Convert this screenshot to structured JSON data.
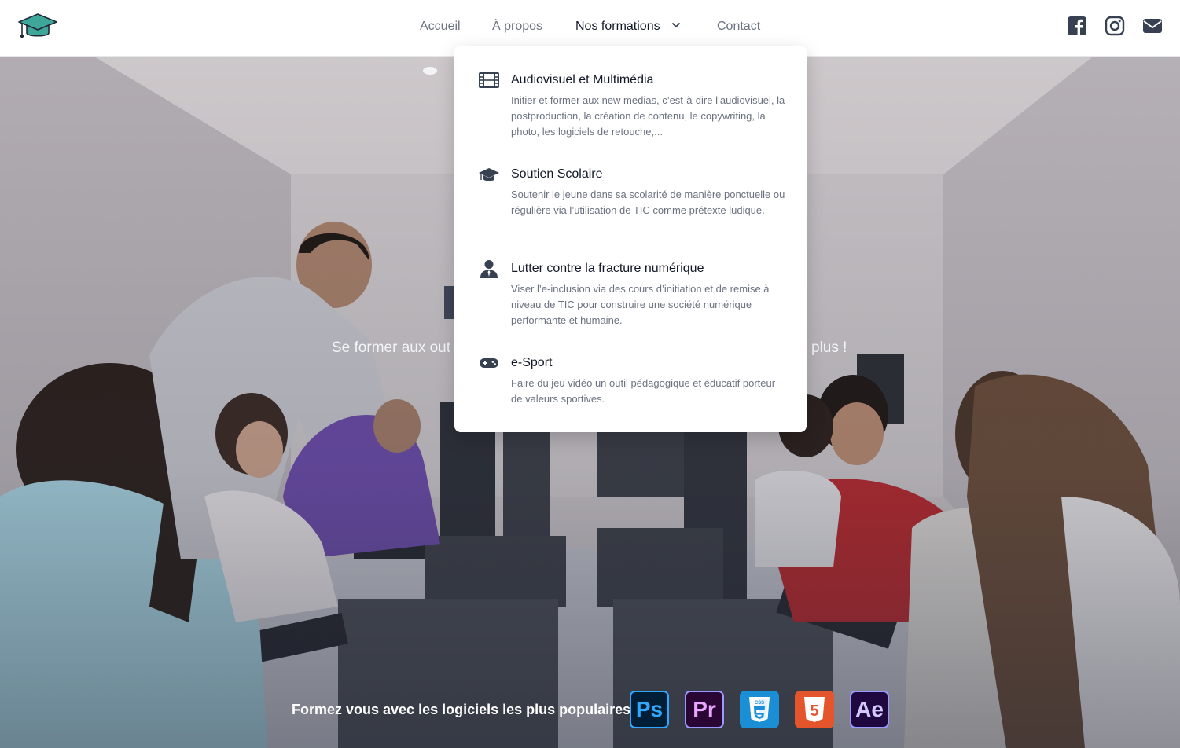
{
  "nav": {
    "items": [
      {
        "label": "Accueil"
      },
      {
        "label": "À propos"
      },
      {
        "label": "Nos formations"
      },
      {
        "label": "Contact"
      }
    ],
    "social": [
      "facebook-icon",
      "instagram-icon",
      "envelope-icon"
    ]
  },
  "dropdown": {
    "items": [
      {
        "icon": "film-icon",
        "title": "Audiovisuel et Multimédia",
        "description": "Initier et former aux new medias, c’est-à-dire l’audiovisuel, la postproduction, la création de contenu, le copywriting, la photo, les logiciels de retouche,..."
      },
      {
        "icon": "graduation-cap-icon",
        "title": "Soutien Scolaire",
        "description": "Soutenir le jeune dans sa scolarité de manière ponctuelle ou régulière via l’utilisation de TIC comme prétexte ludique."
      },
      {
        "icon": "user-tie-icon",
        "title": "Lutter contre la fracture numérique",
        "description": "Viser l’e-inclusion via des cours d’initiation et de remise à niveau de TIC pour construire une société numérique performante et humaine."
      },
      {
        "icon": "gamepad-icon",
        "title": "e-Sport",
        "description": "Faire du jeu vidéo un outil pédagogique et éducatif porteur de valeurs sportives."
      }
    ]
  },
  "hero": {
    "subtitle_left": "Se former aux out",
    "subtitle_right": "plus !",
    "tagline": "Formez vous avec les logiciels les plus populaires !",
    "software": [
      {
        "name": "Ps",
        "icon": "photoshop-icon"
      },
      {
        "name": "Pr",
        "icon": "premiere-icon"
      },
      {
        "name": "CSS",
        "icon": "css3-icon"
      },
      {
        "name": "5",
        "icon": "html5-icon"
      },
      {
        "name": "Ae",
        "icon": "after-effects-icon"
      }
    ]
  },
  "colors": {
    "logo": "#3fa79a",
    "text_dark": "#111827",
    "text_muted": "#6b7280",
    "icon_dark": "#374151"
  }
}
